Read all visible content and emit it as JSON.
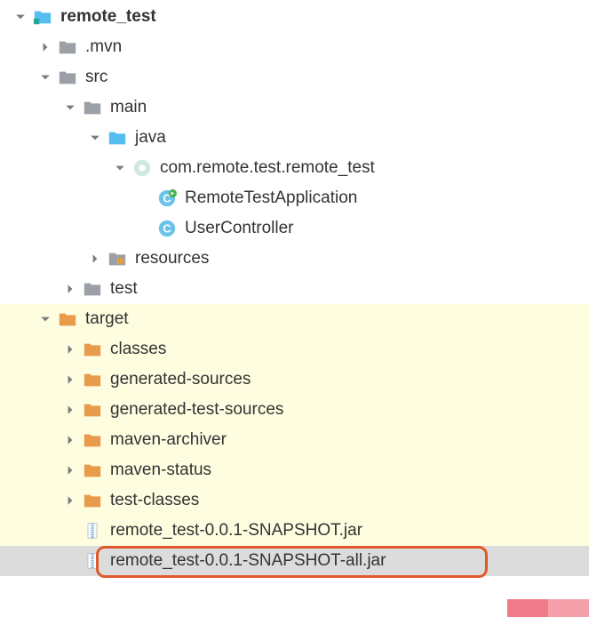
{
  "colors": {
    "folder_gray": "#9aa0a6",
    "folder_blue": "#55bdf0",
    "folder_orange": "#e89b4a",
    "arrow": "#7b7b7b",
    "pkg_bg": "#cfe8db",
    "class_bg": "#6bc4e8",
    "run_badge": "#4caf50",
    "jar_blue": "#7fb8e8",
    "highlight_yellow": "#fffde0",
    "highlight_gray": "#dcdcdc",
    "selection_border": "#e0592c"
  },
  "tree": [
    {
      "id": "root",
      "label": "remote_test",
      "icon": "module-folder",
      "depth": 0,
      "arrow": "down",
      "bold": true,
      "hl": ""
    },
    {
      "id": "mvn",
      "label": ".mvn",
      "icon": "folder-gray",
      "depth": 1,
      "arrow": "right",
      "bold": false,
      "hl": ""
    },
    {
      "id": "src",
      "label": "src",
      "icon": "folder-gray",
      "depth": 1,
      "arrow": "down",
      "bold": false,
      "hl": ""
    },
    {
      "id": "main",
      "label": "main",
      "icon": "folder-gray",
      "depth": 2,
      "arrow": "down",
      "bold": false,
      "hl": ""
    },
    {
      "id": "java",
      "label": "java",
      "icon": "folder-blue",
      "depth": 3,
      "arrow": "down",
      "bold": false,
      "hl": ""
    },
    {
      "id": "pkg",
      "label": "com.remote.test.remote_test",
      "icon": "package",
      "depth": 4,
      "arrow": "down",
      "bold": false,
      "hl": ""
    },
    {
      "id": "app",
      "label": "RemoteTestApplication",
      "icon": "class-run",
      "depth": 5,
      "arrow": "none",
      "bold": false,
      "hl": ""
    },
    {
      "id": "ctrl",
      "label": "UserController",
      "icon": "class",
      "depth": 5,
      "arrow": "none",
      "bold": false,
      "hl": ""
    },
    {
      "id": "res",
      "label": "resources",
      "icon": "resources-folder",
      "depth": 3,
      "arrow": "right",
      "bold": false,
      "hl": ""
    },
    {
      "id": "test",
      "label": "test",
      "icon": "folder-gray",
      "depth": 2,
      "arrow": "right",
      "bold": false,
      "hl": ""
    },
    {
      "id": "target",
      "label": "target",
      "icon": "folder-orange",
      "depth": 1,
      "arrow": "down",
      "bold": false,
      "hl": "yellow"
    },
    {
      "id": "classes",
      "label": "classes",
      "icon": "folder-orange",
      "depth": 2,
      "arrow": "right",
      "bold": false,
      "hl": "yellow"
    },
    {
      "id": "gensrc",
      "label": "generated-sources",
      "icon": "folder-orange",
      "depth": 2,
      "arrow": "right",
      "bold": false,
      "hl": "yellow"
    },
    {
      "id": "gentst",
      "label": "generated-test-sources",
      "icon": "folder-orange",
      "depth": 2,
      "arrow": "right",
      "bold": false,
      "hl": "yellow"
    },
    {
      "id": "march",
      "label": "maven-archiver",
      "icon": "folder-orange",
      "depth": 2,
      "arrow": "right",
      "bold": false,
      "hl": "yellow"
    },
    {
      "id": "mstat",
      "label": "maven-status",
      "icon": "folder-orange",
      "depth": 2,
      "arrow": "right",
      "bold": false,
      "hl": "yellow"
    },
    {
      "id": "tstcls",
      "label": "test-classes",
      "icon": "folder-orange",
      "depth": 2,
      "arrow": "right",
      "bold": false,
      "hl": "yellow"
    },
    {
      "id": "jar1",
      "label": "remote_test-0.0.1-SNAPSHOT.jar",
      "icon": "jar",
      "depth": 2,
      "arrow": "none",
      "bold": false,
      "hl": "yellow"
    },
    {
      "id": "jar2",
      "label": "remote_test-0.0.1-SNAPSHOT-all.jar",
      "icon": "jar",
      "depth": 2,
      "arrow": "none",
      "bold": false,
      "hl": "gray"
    }
  ]
}
